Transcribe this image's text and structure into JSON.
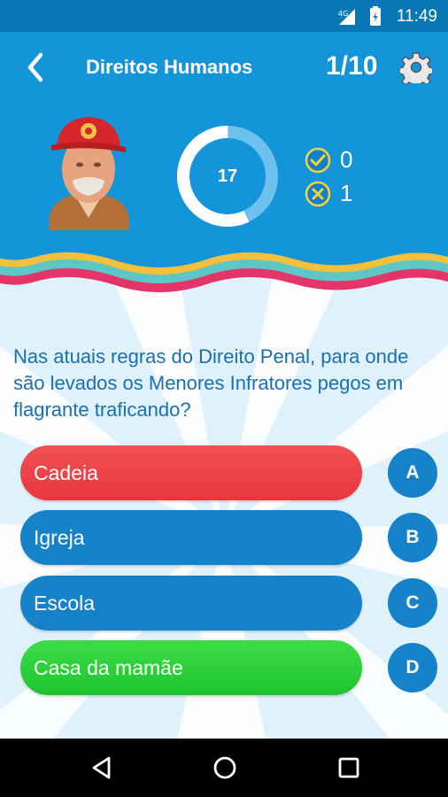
{
  "status_bar": {
    "time": "11:49",
    "network": "4G"
  },
  "app_bar": {
    "title": "Direitos Humanos",
    "progress": "1/10"
  },
  "quiz": {
    "timer": "17",
    "timer_fraction": 0.57,
    "correct_count": "0",
    "wrong_count": "1",
    "question": "Nas atuais regras do Direito Penal, para onde são levados os Menores Infratores pegos em flagrante traficando?",
    "answers": [
      {
        "letter": "A",
        "text": "Cadeia",
        "state": "wrong",
        "color": "#e8373d"
      },
      {
        "letter": "B",
        "text": "Igreja",
        "state": "neutral",
        "color": "#1582c9"
      },
      {
        "letter": "C",
        "text": "Escola",
        "state": "neutral",
        "color": "#1582c9"
      },
      {
        "letter": "D",
        "text": "Casa da mamãe",
        "state": "correct",
        "color": "#1ec430"
      }
    ]
  },
  "colors": {
    "primary": "#1595d9",
    "status_bar": "#0a77b5",
    "accent_yellow": "#f4d23b"
  }
}
